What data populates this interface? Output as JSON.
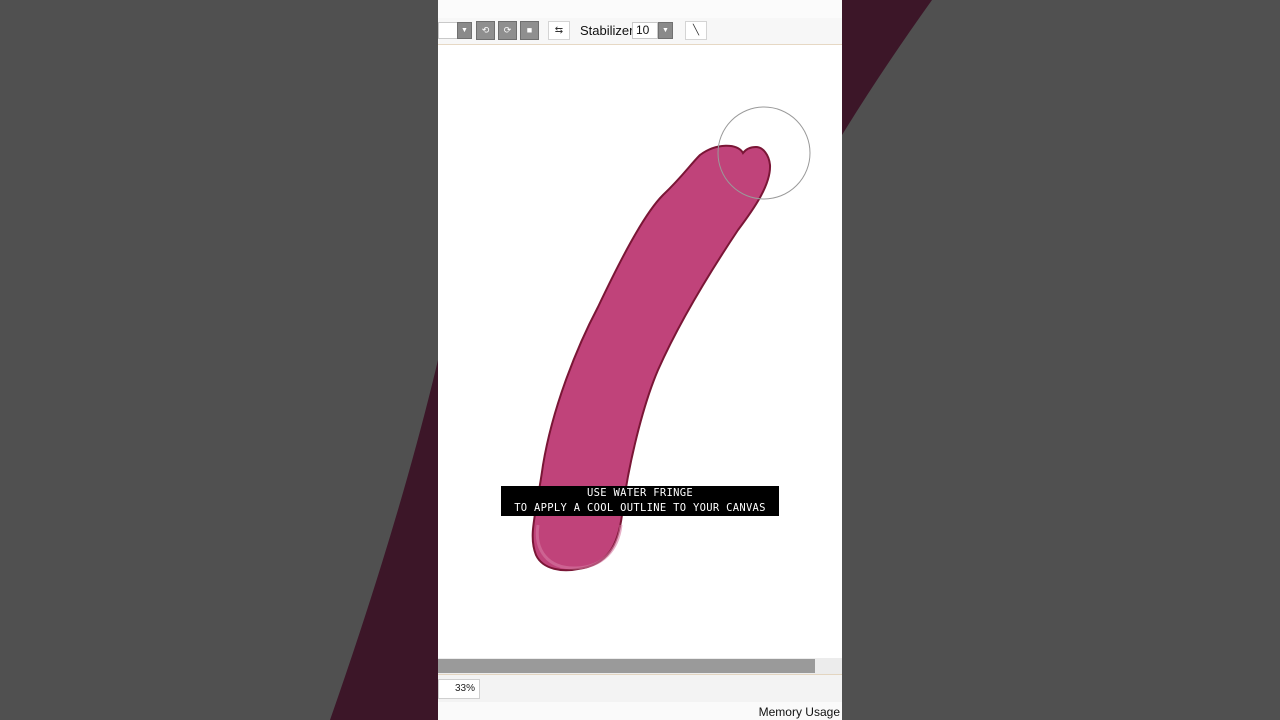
{
  "toolbar": {
    "stabilizer_label": "Stabilizer",
    "stabilizer_value": "10",
    "dropdown_icon": "chevron-down-icon",
    "buttons": [
      "rotate-left-icon",
      "rotate-right-icon",
      "reset-icon",
      "flip-icon",
      "line-tool-icon"
    ]
  },
  "caption": {
    "line1": "USE WATER FRINGE",
    "line2": "TO APPLY A COOL OUTLINE TO YOUR CANVAS"
  },
  "status": {
    "zoom": "33%",
    "memory_label": "Memory Usage"
  },
  "colors": {
    "stroke_fill": "#c0437a",
    "stroke_outline": "#7a1636",
    "background": "#505050",
    "dark_band": "#3c1628"
  }
}
